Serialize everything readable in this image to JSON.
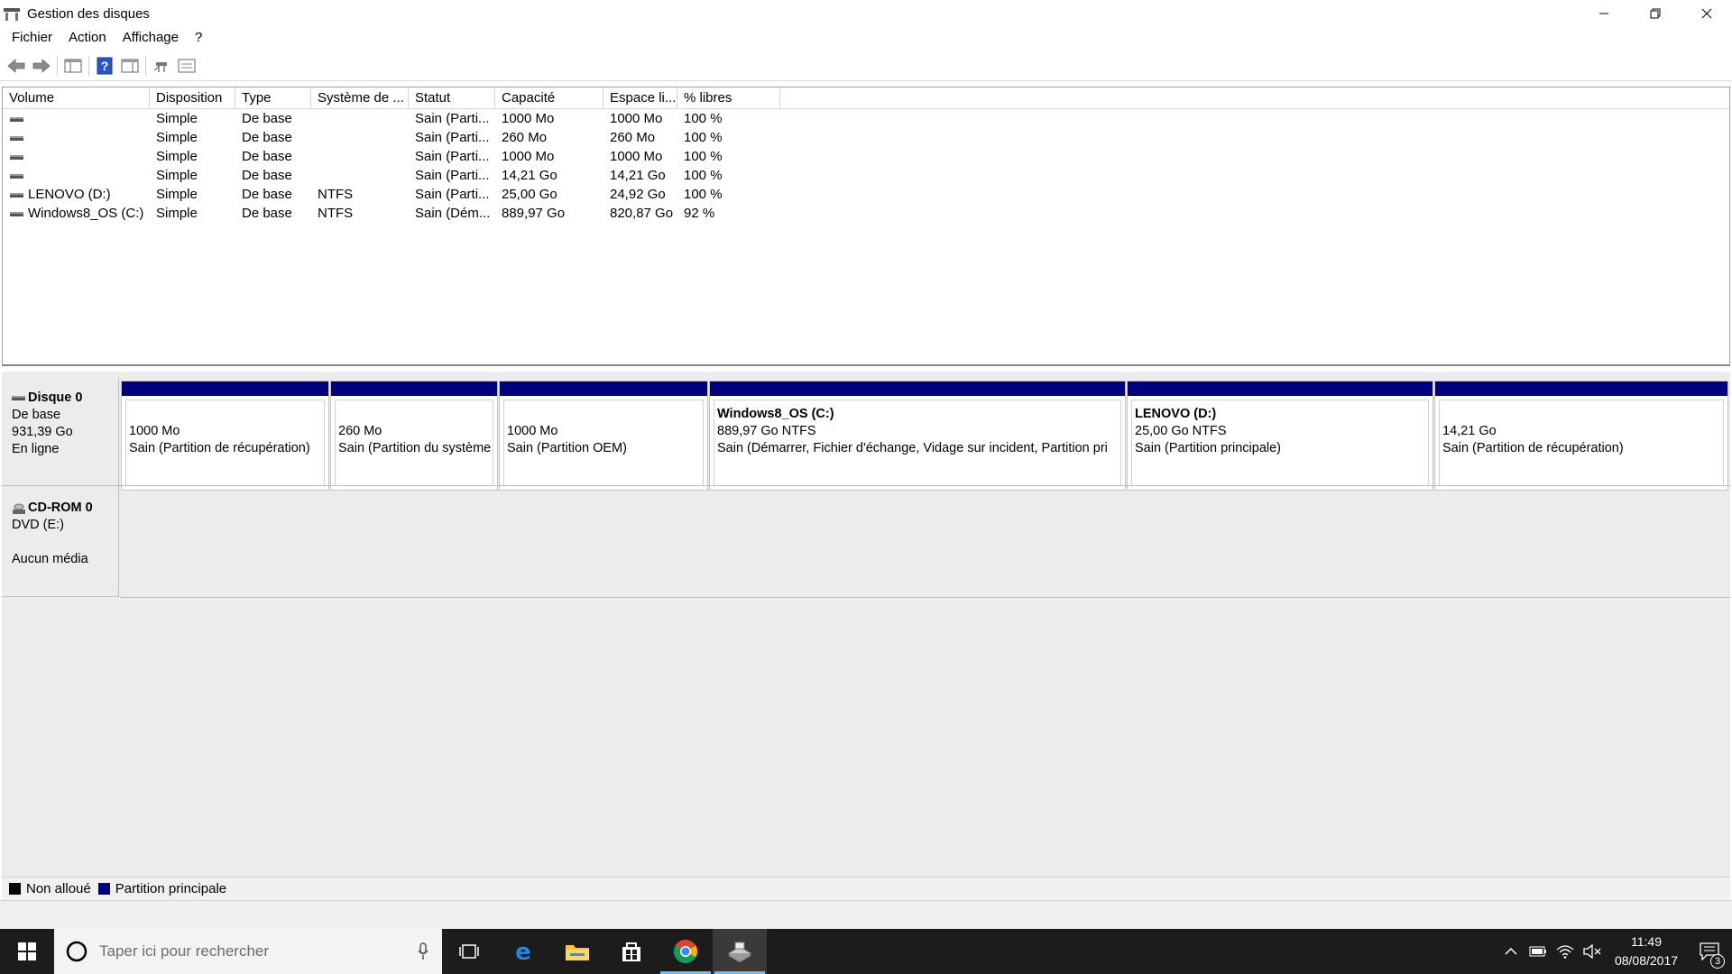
{
  "window": {
    "title": "Gestion des disques",
    "controls": [
      "minimize",
      "restore",
      "close"
    ]
  },
  "menu": [
    "Fichier",
    "Action",
    "Affichage",
    "?"
  ],
  "toolbar": {
    "buttons": [
      "back-arrow-icon",
      "forward-arrow-icon",
      "console-tree-icon",
      "help-icon",
      "properties-panel-icon",
      "rescan-icon",
      "detail-view-icon"
    ]
  },
  "volumes": {
    "columns": [
      "Volume",
      "Disposition",
      "Type",
      "Système de ...",
      "Statut",
      "Capacité",
      "Espace li...",
      "% libres"
    ],
    "rows": [
      {
        "volume": "",
        "disposition": "Simple",
        "type": "De base",
        "fs": "",
        "status": "Sain (Parti...",
        "capacity": "1000 Mo",
        "free": "1000 Mo",
        "pct": "100 %"
      },
      {
        "volume": "",
        "disposition": "Simple",
        "type": "De base",
        "fs": "",
        "status": "Sain (Parti...",
        "capacity": "260 Mo",
        "free": "260 Mo",
        "pct": "100 %"
      },
      {
        "volume": "",
        "disposition": "Simple",
        "type": "De base",
        "fs": "",
        "status": "Sain (Parti...",
        "capacity": "1000 Mo",
        "free": "1000 Mo",
        "pct": "100 %"
      },
      {
        "volume": "",
        "disposition": "Simple",
        "type": "De base",
        "fs": "",
        "status": "Sain (Parti...",
        "capacity": "14,21 Go",
        "free": "14,21 Go",
        "pct": "100 %"
      },
      {
        "volume": "LENOVO (D:)",
        "disposition": "Simple",
        "type": "De base",
        "fs": "NTFS",
        "status": "Sain (Parti...",
        "capacity": "25,00 Go",
        "free": "24,92 Go",
        "pct": "100 %"
      },
      {
        "volume": "Windows8_OS (C:)",
        "disposition": "Simple",
        "type": "De base",
        "fs": "NTFS",
        "status": "Sain (Dém...",
        "capacity": "889,97 Go",
        "free": "820,87 Go",
        "pct": "92 %"
      }
    ]
  },
  "disk0": {
    "name": "Disque 0",
    "type": "De base",
    "size": "931,39 Go",
    "state": "En ligne",
    "partitions": [
      {
        "name": "",
        "size": "1000 Mo",
        "status": "Sain (Partition de récupération)"
      },
      {
        "name": "",
        "size": "260 Mo",
        "status": "Sain (Partition du système"
      },
      {
        "name": "",
        "size": "1000 Mo",
        "status": "Sain (Partition OEM)"
      },
      {
        "name": "Windows8_OS  (C:)",
        "size": "889,97 Go NTFS",
        "status": "Sain (Démarrer, Fichier d'échange, Vidage sur incident, Partition pri"
      },
      {
        "name": "LENOVO  (D:)",
        "size": "25,00 Go NTFS",
        "status": "Sain (Partition principale)"
      },
      {
        "name": "",
        "size": "14,21 Go",
        "status": "Sain (Partition de récupération)"
      }
    ]
  },
  "cdrom0": {
    "name": "CD-ROM 0",
    "drive": "DVD (E:)",
    "state": "Aucun média"
  },
  "legend": {
    "unallocated": "Non alloué",
    "primary": "Partition principale",
    "colors": {
      "unallocated": "#000000",
      "primary": "#000080"
    }
  },
  "taskbar": {
    "search_placeholder": "Taper ici pour rechercher",
    "apps": [
      "task-view-icon",
      "edge-icon",
      "file-explorer-icon",
      "store-icon",
      "chrome-icon",
      "disk-management-icon"
    ],
    "time": "11:49",
    "date": "08/08/2017",
    "notification_count": "3"
  }
}
